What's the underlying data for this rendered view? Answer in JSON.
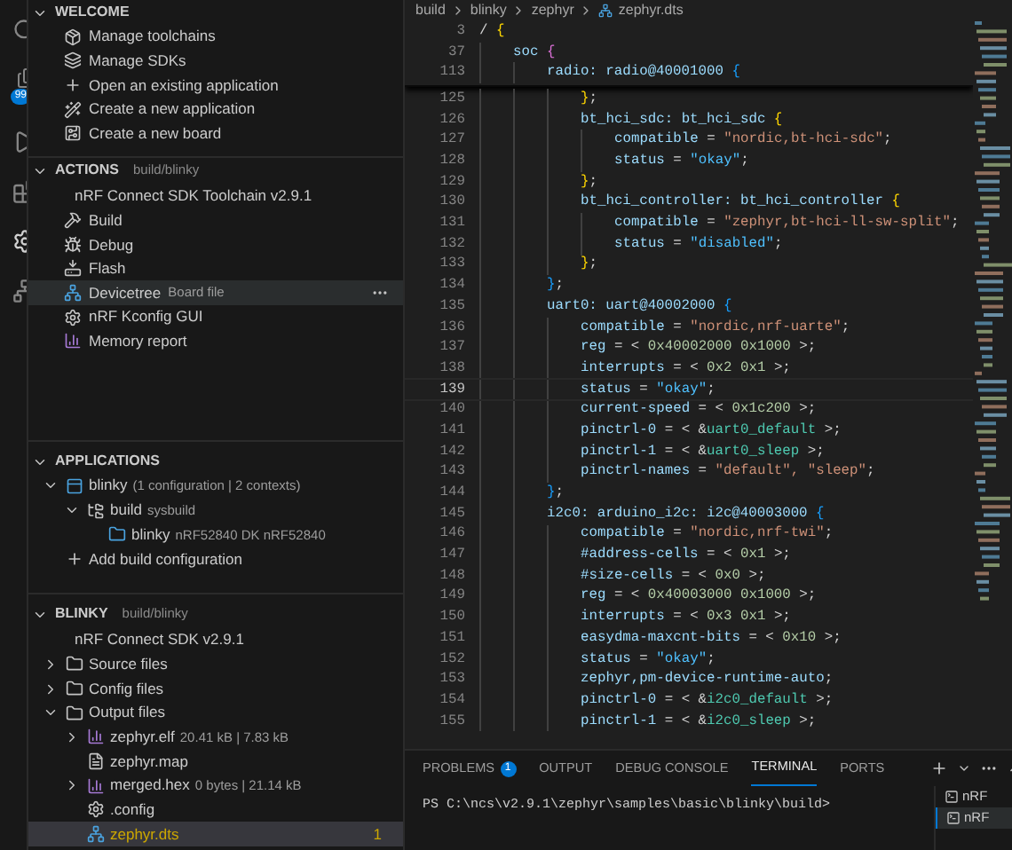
{
  "activity_bar": {
    "badge": "99"
  },
  "welcome": {
    "title": "WELCOME",
    "items": [
      {
        "kind": "toolchain",
        "label": "Manage toolchains"
      },
      {
        "kind": "sdk",
        "label": "Manage SDKs"
      },
      {
        "kind": "add",
        "label": "Open an existing application"
      },
      {
        "kind": "wand",
        "label": "Create a new application"
      },
      {
        "kind": "board",
        "label": "Create a new board"
      }
    ]
  },
  "actions": {
    "title": "ACTIONS",
    "subtitle": "build/blinky",
    "toolchain": "nRF Connect SDK Toolchain v2.9.1",
    "items": [
      {
        "kind": "build",
        "label": "Build",
        "selected": false
      },
      {
        "kind": "debug",
        "label": "Debug",
        "selected": false
      },
      {
        "kind": "flash",
        "label": "Flash",
        "selected": false
      },
      {
        "kind": "devicetree",
        "label": "Devicetree",
        "detail": "Board file",
        "selected": true
      },
      {
        "kind": "gear",
        "label": "nRF Kconfig GUI",
        "selected": false
      },
      {
        "kind": "chart",
        "label": "Memory report",
        "selected": false
      }
    ]
  },
  "applications": {
    "title": "APPLICATIONS",
    "tree": [
      {
        "kind": "app",
        "label": "blinky",
        "detail": "(1 configuration | 2 contexts)",
        "expanded": true,
        "children": [
          {
            "kind": "buildfolder",
            "label": "build",
            "detail": "sysbuild",
            "expanded": true,
            "children": [
              {
                "kind": "domain",
                "label": "blinky",
                "detail": "nRF52840 DK nRF52840"
              }
            ]
          }
        ]
      },
      {
        "kind": "add",
        "label": "Add build configuration"
      }
    ]
  },
  "blinky": {
    "title": "BLINKY",
    "subtitle": "build/blinky",
    "sdk": "nRF Connect SDK v2.9.1",
    "tree": [
      {
        "kind": "folder",
        "label": "Source files",
        "expanded": false
      },
      {
        "kind": "folder",
        "label": "Config files",
        "expanded": false
      },
      {
        "kind": "folder",
        "label": "Output files",
        "expanded": true,
        "children": [
          {
            "kind": "chart",
            "label": "zephyr.elf",
            "detail": "20.41 kB | 7.83 kB",
            "expanded": false
          },
          {
            "kind": "text",
            "label": "zephyr.map"
          },
          {
            "kind": "chart",
            "label": "merged.hex",
            "detail": "0 bytes | 21.14 kB",
            "expanded": false
          },
          {
            "kind": "gear",
            "label": ".config"
          },
          {
            "kind": "devicetree",
            "label": "zephyr.dts",
            "selected": true,
            "badge": "1"
          }
        ]
      }
    ]
  },
  "breadcrumb": [
    "build",
    "blinky",
    "zephyr",
    "zephyr.dts"
  ],
  "sticky_lines": [
    {
      "number": "3",
      "tokens": [
        {
          "kind": "plain",
          "text": "/ "
        },
        {
          "kind": "brace",
          "text": "{"
        }
      ],
      "children": [
        {
          "number": "37",
          "tokens": [
            {
              "kind": "label",
              "text": "soc "
            },
            {
              "kind": "brace2",
              "text": "{"
            }
          ],
          "children": [
            {
              "number": "113",
              "tokens": [
                {
                  "kind": "label",
                  "text": "radio: radio@40001000 "
                },
                {
                  "kind": "brace3",
                  "text": "{"
                }
              ]
            }
          ]
        }
      ]
    }
  ],
  "radio_body": [
    {
      "number": "125",
      "current": false,
      "tokens": [
        {
          "kind": "brace",
          "text": "}"
        },
        {
          "kind": "plain",
          "text": ";"
        }
      ]
    },
    {
      "number": "126",
      "current": false,
      "tokens": [
        {
          "kind": "label",
          "text": "bt_hci_sdc: bt_hci_sdc "
        },
        {
          "kind": "brace",
          "text": "{"
        }
      ],
      "children": [
        {
          "number": "127",
          "current": false,
          "tokens": [
            {
              "kind": "prop",
              "text": "compatible"
            },
            {
              "kind": "plain",
              "text": " = "
            },
            {
              "kind": "str",
              "text": "\"nordic,bt-hci-sdc\""
            },
            {
              "kind": "plain",
              "text": ";"
            }
          ]
        },
        {
          "number": "128",
          "current": false,
          "tokens": [
            {
              "kind": "prop",
              "text": "status"
            },
            {
              "kind": "plain",
              "text": " = "
            },
            {
              "kind": "enum",
              "text": "\"okay\""
            },
            {
              "kind": "plain",
              "text": ";"
            }
          ]
        }
      ]
    },
    {
      "number": "129",
      "current": false,
      "tokens": [
        {
          "kind": "brace",
          "text": "}"
        },
        {
          "kind": "plain",
          "text": ";"
        }
      ]
    },
    {
      "number": "130",
      "current": false,
      "tokens": [
        {
          "kind": "label",
          "text": "bt_hci_controller: bt_hci_controller "
        },
        {
          "kind": "brace",
          "text": "{"
        }
      ],
      "children": [
        {
          "number": "131",
          "current": false,
          "tokens": [
            {
              "kind": "prop",
              "text": "compatible"
            },
            {
              "kind": "plain",
              "text": " = "
            },
            {
              "kind": "str",
              "text": "\"zephyr,bt-hci-ll-sw-split\""
            },
            {
              "kind": "plain",
              "text": ";"
            }
          ]
        },
        {
          "number": "132",
          "current": false,
          "tokens": [
            {
              "kind": "prop",
              "text": "status"
            },
            {
              "kind": "plain",
              "text": " = "
            },
            {
              "kind": "enum",
              "text": "\"disabled\""
            },
            {
              "kind": "plain",
              "text": ";"
            }
          ]
        }
      ]
    },
    {
      "number": "133",
      "current": false,
      "tokens": [
        {
          "kind": "brace",
          "text": "}"
        },
        {
          "kind": "plain",
          "text": ";"
        }
      ]
    }
  ],
  "soc_body": [
    {
      "number": "134",
      "current": false,
      "tokens": [
        {
          "kind": "brace3",
          "text": "}"
        },
        {
          "kind": "plain",
          "text": ";"
        }
      ]
    },
    {
      "number": "135",
      "current": false,
      "tokens": [
        {
          "kind": "label",
          "text": "uart0: uart@40002000 "
        },
        {
          "kind": "brace3",
          "text": "{"
        }
      ],
      "children": [
        {
          "number": "136",
          "current": false,
          "tokens": [
            {
              "kind": "prop",
              "text": "compatible"
            },
            {
              "kind": "plain",
              "text": " = "
            },
            {
              "kind": "str",
              "text": "\"nordic,nrf-uarte\""
            },
            {
              "kind": "plain",
              "text": ";"
            }
          ]
        },
        {
          "number": "137",
          "current": false,
          "tokens": [
            {
              "kind": "prop",
              "text": "reg"
            },
            {
              "kind": "plain",
              "text": " = < "
            },
            {
              "kind": "num",
              "text": "0x40002000 0x1000"
            },
            {
              "kind": "plain",
              "text": " >;"
            }
          ]
        },
        {
          "number": "138",
          "current": false,
          "tokens": [
            {
              "kind": "prop",
              "text": "interrupts"
            },
            {
              "kind": "plain",
              "text": " = < "
            },
            {
              "kind": "num",
              "text": "0x2 0x1"
            },
            {
              "kind": "plain",
              "text": " >;"
            }
          ]
        },
        {
          "number": "139",
          "current": true,
          "tokens": [
            {
              "kind": "prop",
              "text": "status"
            },
            {
              "kind": "plain",
              "text": " = "
            },
            {
              "kind": "enum",
              "text": "\"okay\""
            },
            {
              "kind": "plain",
              "text": ";"
            }
          ]
        },
        {
          "number": "140",
          "current": false,
          "tokens": [
            {
              "kind": "prop",
              "text": "current-speed"
            },
            {
              "kind": "plain",
              "text": " = < "
            },
            {
              "kind": "num",
              "text": "0x1c200"
            },
            {
              "kind": "plain",
              "text": " >;"
            }
          ]
        },
        {
          "number": "141",
          "current": false,
          "tokens": [
            {
              "kind": "prop",
              "text": "pinctrl-0"
            },
            {
              "kind": "plain",
              "text": " = < &"
            },
            {
              "kind": "ref",
              "text": "uart0_default"
            },
            {
              "kind": "plain",
              "text": " >;"
            }
          ]
        },
        {
          "number": "142",
          "current": false,
          "tokens": [
            {
              "kind": "prop",
              "text": "pinctrl-1"
            },
            {
              "kind": "plain",
              "text": " = < &"
            },
            {
              "kind": "ref",
              "text": "uart0_sleep"
            },
            {
              "kind": "plain",
              "text": " >;"
            }
          ]
        },
        {
          "number": "143",
          "current": false,
          "tokens": [
            {
              "kind": "prop",
              "text": "pinctrl-names"
            },
            {
              "kind": "plain",
              "text": " = "
            },
            {
              "kind": "str",
              "text": "\"default\", \"sleep\""
            },
            {
              "kind": "plain",
              "text": ";"
            }
          ]
        }
      ]
    },
    {
      "number": "144",
      "current": false,
      "tokens": [
        {
          "kind": "brace3",
          "text": "}"
        },
        {
          "kind": "plain",
          "text": ";"
        }
      ]
    },
    {
      "number": "145",
      "current": false,
      "tokens": [
        {
          "kind": "label",
          "text": "i2c0: arduino_i2c: i2c@40003000 "
        },
        {
          "kind": "brace3",
          "text": "{"
        }
      ],
      "children": [
        {
          "number": "146",
          "current": false,
          "tokens": [
            {
              "kind": "prop",
              "text": "compatible"
            },
            {
              "kind": "plain",
              "text": " = "
            },
            {
              "kind": "str",
              "text": "\"nordic,nrf-twi\""
            },
            {
              "kind": "plain",
              "text": ";"
            }
          ]
        },
        {
          "number": "147",
          "current": false,
          "tokens": [
            {
              "kind": "prop",
              "text": "#address-cells"
            },
            {
              "kind": "plain",
              "text": " = < "
            },
            {
              "kind": "num",
              "text": "0x1"
            },
            {
              "kind": "plain",
              "text": " >;"
            }
          ]
        },
        {
          "number": "148",
          "current": false,
          "tokens": [
            {
              "kind": "prop",
              "text": "#size-cells"
            },
            {
              "kind": "plain",
              "text": " = < "
            },
            {
              "kind": "num",
              "text": "0x0"
            },
            {
              "kind": "plain",
              "text": " >;"
            }
          ]
        },
        {
          "number": "149",
          "current": false,
          "tokens": [
            {
              "kind": "prop",
              "text": "reg"
            },
            {
              "kind": "plain",
              "text": " = < "
            },
            {
              "kind": "num",
              "text": "0x40003000 0x1000"
            },
            {
              "kind": "plain",
              "text": " >;"
            }
          ]
        },
        {
          "number": "150",
          "current": false,
          "tokens": [
            {
              "kind": "prop",
              "text": "interrupts"
            },
            {
              "kind": "plain",
              "text": " = < "
            },
            {
              "kind": "num",
              "text": "0x3 0x1"
            },
            {
              "kind": "plain",
              "text": " >;"
            }
          ]
        },
        {
          "number": "151",
          "current": false,
          "tokens": [
            {
              "kind": "prop",
              "text": "easydma-maxcnt-bits"
            },
            {
              "kind": "plain",
              "text": " = < "
            },
            {
              "kind": "num",
              "text": "0x10"
            },
            {
              "kind": "plain",
              "text": " >;"
            }
          ]
        },
        {
          "number": "152",
          "current": false,
          "tokens": [
            {
              "kind": "prop",
              "text": "status"
            },
            {
              "kind": "plain",
              "text": " = "
            },
            {
              "kind": "enum",
              "text": "\"okay\""
            },
            {
              "kind": "plain",
              "text": ";"
            }
          ]
        },
        {
          "number": "153",
          "current": false,
          "tokens": [
            {
              "kind": "prop",
              "text": "zephyr,pm-device-runtime-auto"
            },
            {
              "kind": "plain",
              "text": ";"
            }
          ]
        },
        {
          "number": "154",
          "current": false,
          "tokens": [
            {
              "kind": "prop",
              "text": "pinctrl-0"
            },
            {
              "kind": "plain",
              "text": " = < &"
            },
            {
              "kind": "ref",
              "text": "i2c0_default"
            },
            {
              "kind": "plain",
              "text": " >;"
            }
          ]
        },
        {
          "number": "155",
          "current": false,
          "tokens": [
            {
              "kind": "prop",
              "text": "pinctrl-1"
            },
            {
              "kind": "plain",
              "text": " = < &"
            },
            {
              "kind": "ref",
              "text": "i2c0_sleep"
            },
            {
              "kind": "plain",
              "text": " >;"
            }
          ]
        }
      ]
    }
  ],
  "panel": {
    "tabs": [
      {
        "label": "PROBLEMS",
        "badge": "1",
        "selected": false
      },
      {
        "label": "OUTPUT",
        "selected": false
      },
      {
        "label": "DEBUG CONSOLE",
        "selected": false
      },
      {
        "label": "TERMINAL",
        "selected": true
      },
      {
        "label": "PORTS",
        "selected": false
      }
    ],
    "terminal_text": "PS C:\\ncs\\v2.9.1\\zephyr\\samples\\basic\\blinky\\build>",
    "terminals": [
      {
        "label": "nRF",
        "selected": false
      },
      {
        "label": "nRF",
        "selected": true
      }
    ]
  }
}
